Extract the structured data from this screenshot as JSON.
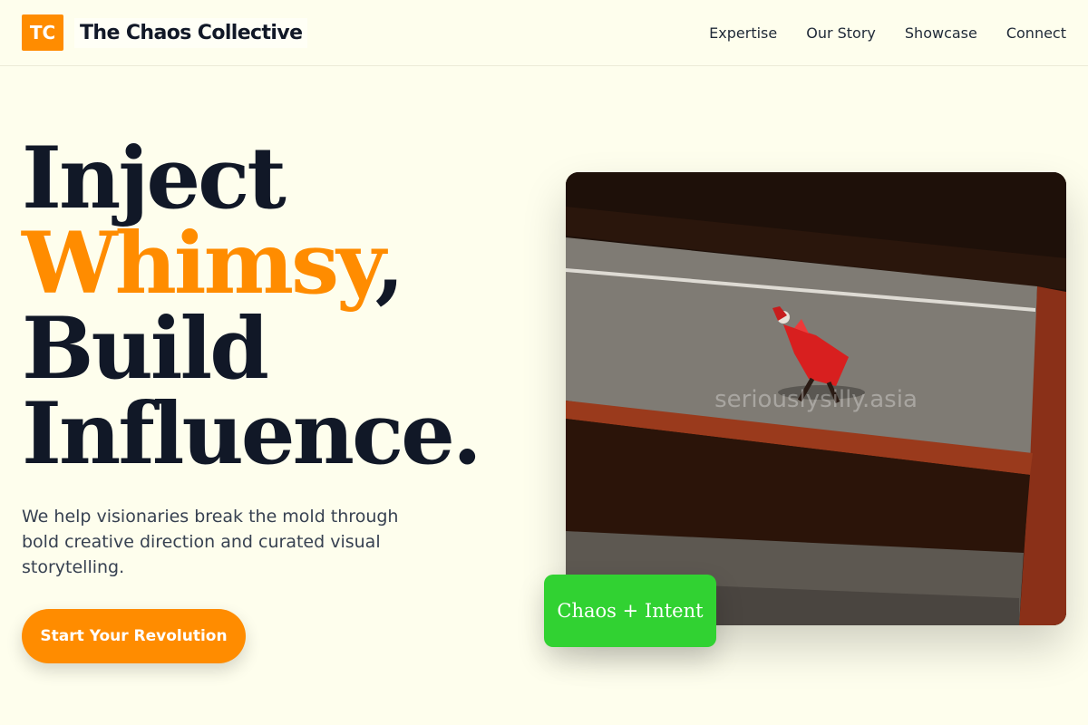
{
  "brand": {
    "logo_initials": "TC",
    "name": "The Chaos Collective",
    "accent_color": "#ff8c00"
  },
  "nav": {
    "items": [
      {
        "label": "Expertise"
      },
      {
        "label": "Our Story"
      },
      {
        "label": "Showcase"
      },
      {
        "label": "Connect"
      }
    ]
  },
  "hero": {
    "title": {
      "line1": "Inject",
      "line2_accent": "Whimsy",
      "line2_punct": ",",
      "line3": "Build",
      "line4": "Influence."
    },
    "subtitle": "We help visionaries break the mold through bold creative direction and curated visual storytelling.",
    "cta_label": "Start Your Revolution"
  },
  "showcase": {
    "watermark": "seriouslysilly.asia",
    "tag_label": "Chaos + Intent",
    "tag_color": "#31d232"
  }
}
